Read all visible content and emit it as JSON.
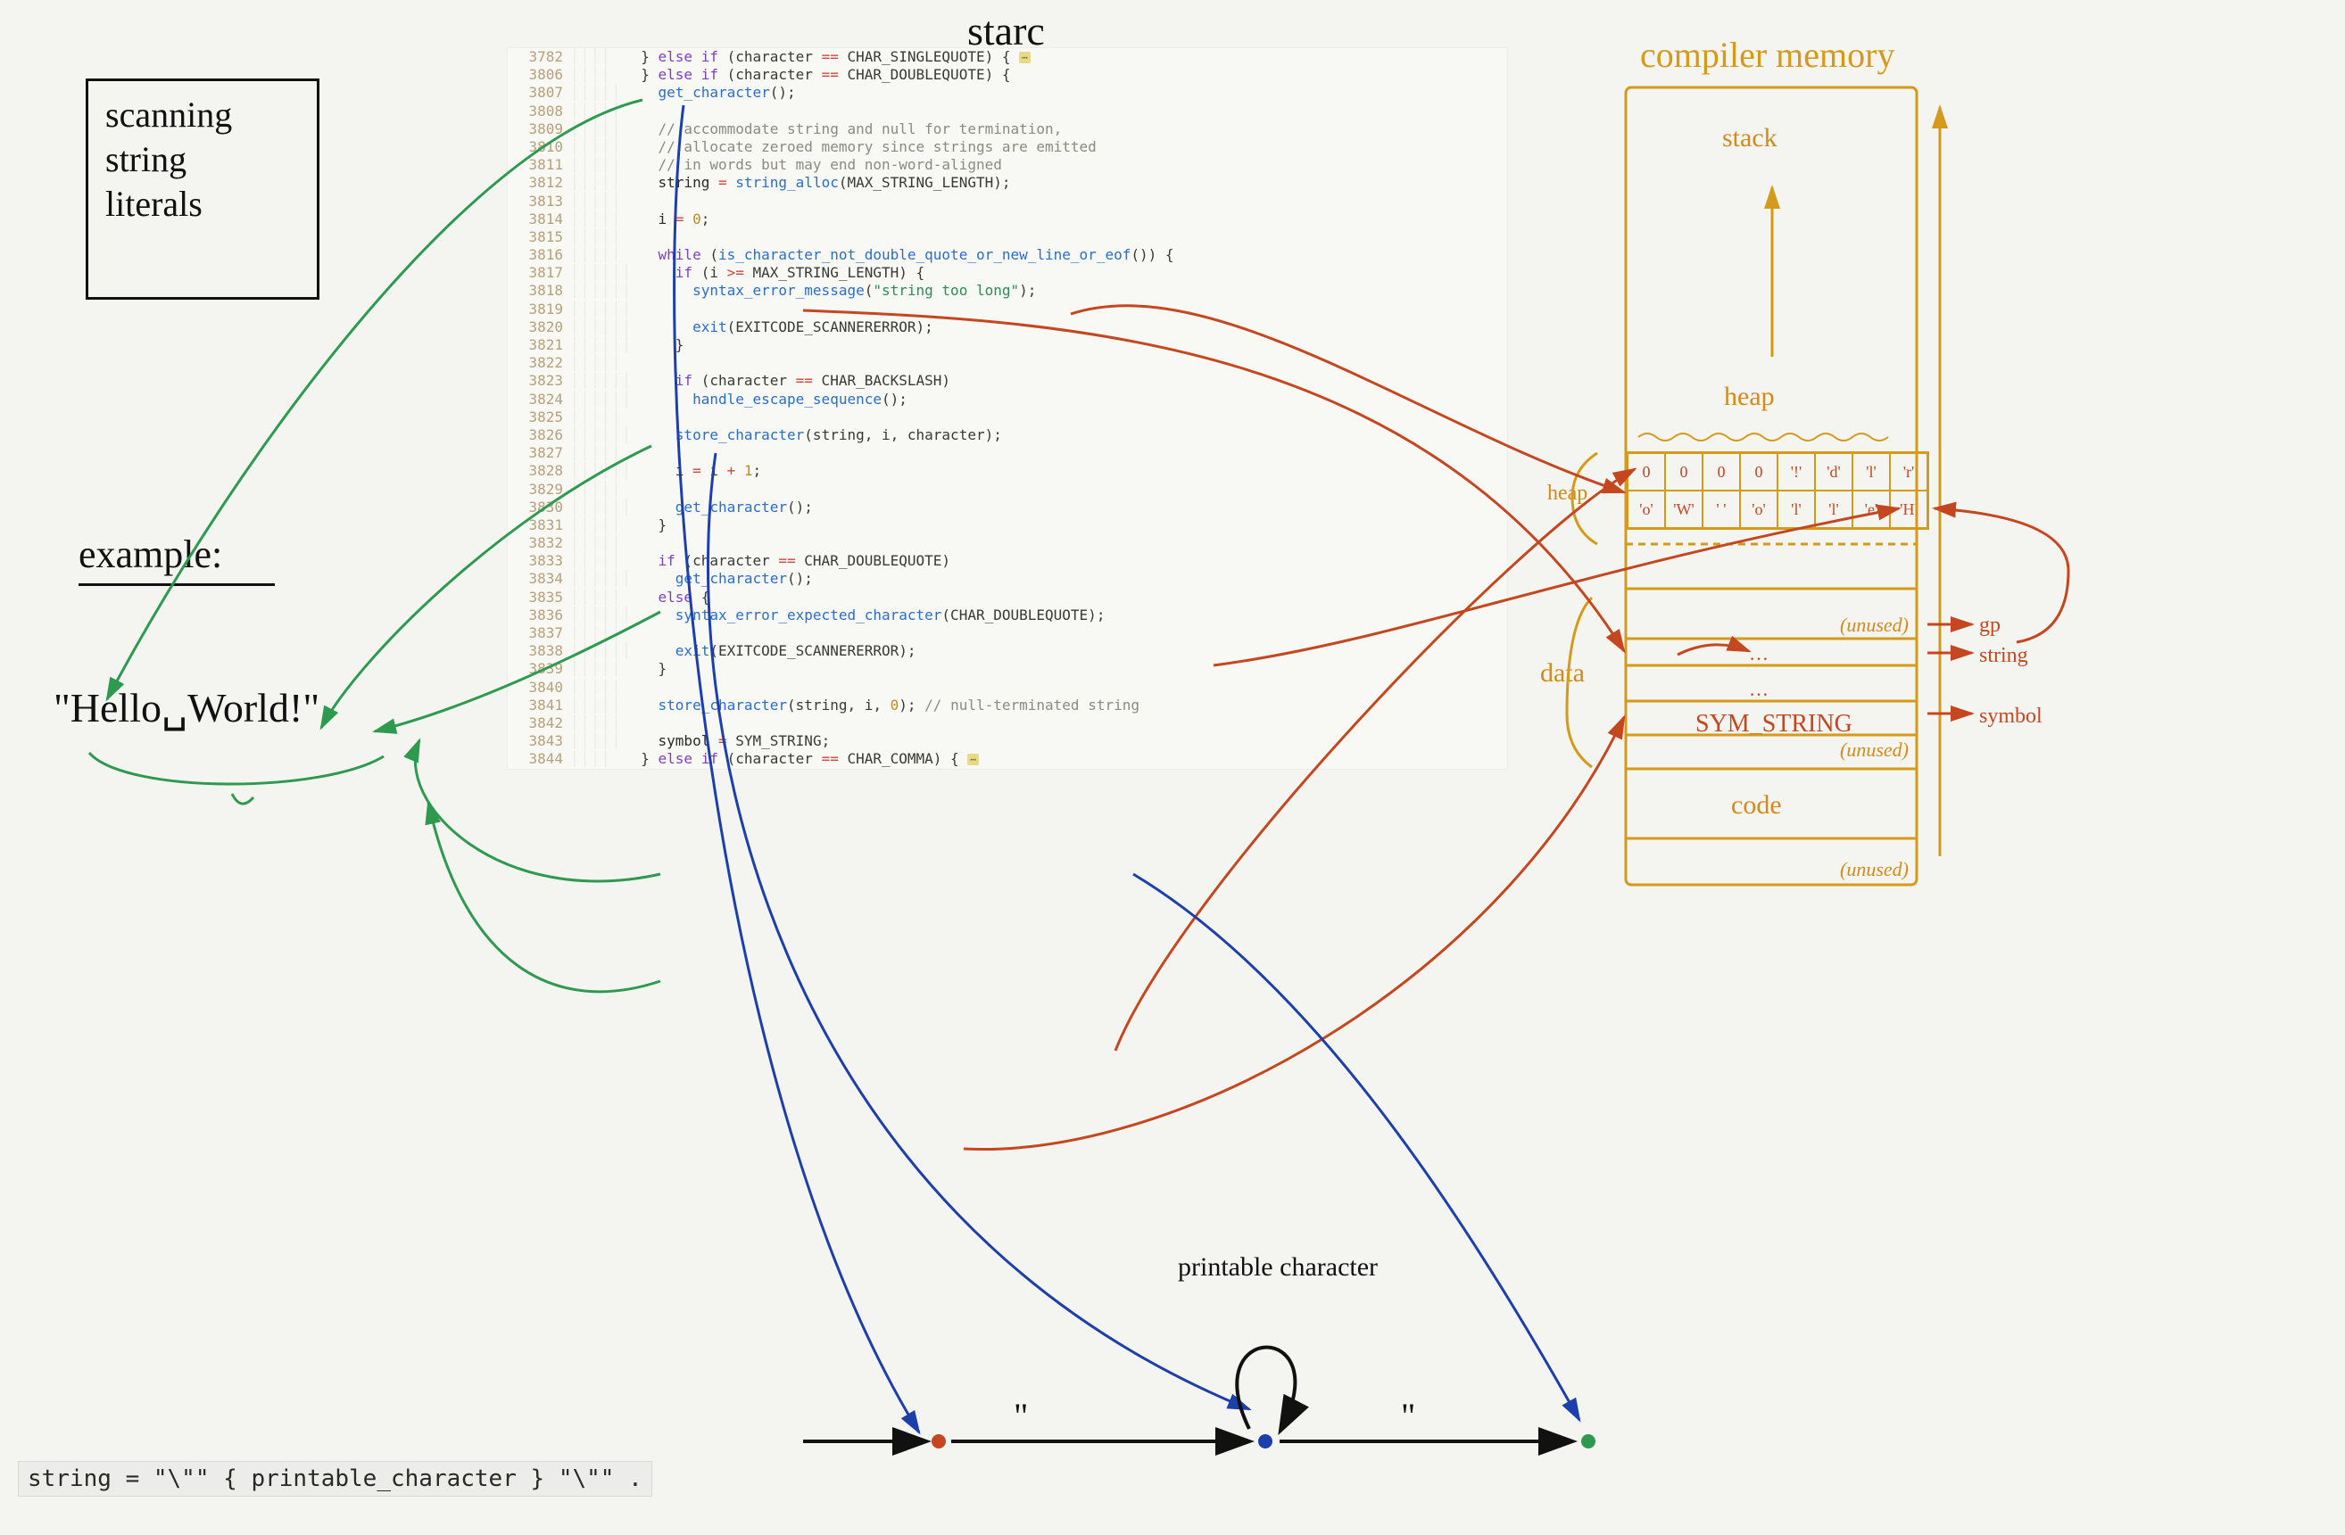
{
  "title_hw": "starc",
  "box": {
    "l1": "scanning",
    "l2": "string",
    "l3": "literals"
  },
  "example_label": "example:",
  "hello": "\"Hello␣World!\"",
  "grammar": "string     = \"\\\"\" { printable_character } \"\\\"\" .",
  "printable_label": "printable character",
  "memory": {
    "title": "compiler memory",
    "stack": "stack",
    "heap": "heap",
    "heap_side": "heap",
    "data": "data",
    "code": "code",
    "sym": "SYM_STRING",
    "unused": "(unused)",
    "gp": "gp",
    "string_ptr": "string",
    "symbol_ptr": "symbol",
    "dots": "…",
    "row1": [
      "0",
      "0",
      "0",
      "0",
      "'!'",
      "'d'",
      "'l'",
      "'r'"
    ],
    "row2": [
      "'o'",
      "'W'",
      "' '",
      "'o'",
      "'l'",
      "'l'",
      "'e'",
      "'H'"
    ]
  },
  "fsm": {
    "q1": "\"",
    "q2": "\""
  },
  "code": {
    "start": 3782,
    "lines": [
      {
        "n": 3782,
        "ind": 4,
        "seg": [
          [
            "",
            "} "
          ],
          [
            "kw",
            "else if"
          ],
          [
            "",
            " (character "
          ],
          [
            "op",
            "=="
          ],
          [
            "",
            " CHAR_SINGLEQUOTE) { "
          ]
        ],
        "fold": true
      },
      {
        "n": 3806,
        "ind": 4,
        "seg": [
          [
            "",
            "} "
          ],
          [
            "kw",
            "else if"
          ],
          [
            "",
            " (character "
          ],
          [
            "op",
            "=="
          ],
          [
            "",
            " CHAR_DOUBLEQUOTE) {"
          ]
        ]
      },
      {
        "n": 3807,
        "ind": 5,
        "seg": [
          [
            "fn",
            "get_character"
          ],
          [
            "",
            "();"
          ]
        ]
      },
      {
        "n": 3808,
        "ind": 5,
        "seg": []
      },
      {
        "n": 3809,
        "ind": 5,
        "seg": [
          [
            "cmt",
            "// accommodate string and null for termination,"
          ]
        ]
      },
      {
        "n": 3810,
        "ind": 5,
        "seg": [
          [
            "cmt",
            "// allocate zeroed memory since strings are emitted"
          ]
        ]
      },
      {
        "n": 3811,
        "ind": 5,
        "seg": [
          [
            "cmt",
            "// in words but may end non-word-aligned"
          ]
        ]
      },
      {
        "n": 3812,
        "ind": 5,
        "seg": [
          [
            "id",
            "string"
          ],
          [
            "",
            " "
          ],
          [
            "op",
            "="
          ],
          [
            "",
            " "
          ],
          [
            "fn",
            "string_alloc"
          ],
          [
            "",
            "(MAX_STRING_LENGTH);"
          ]
        ]
      },
      {
        "n": 3813,
        "ind": 5,
        "seg": []
      },
      {
        "n": 3814,
        "ind": 5,
        "seg": [
          [
            "id",
            "i"
          ],
          [
            "",
            " "
          ],
          [
            "op",
            "="
          ],
          [
            "",
            " "
          ],
          [
            "num",
            "0"
          ],
          [
            "",
            ";"
          ]
        ]
      },
      {
        "n": 3815,
        "ind": 5,
        "seg": []
      },
      {
        "n": 3816,
        "ind": 5,
        "seg": [
          [
            "kw",
            "while"
          ],
          [
            "",
            " ("
          ],
          [
            "fn",
            "is_character_not_double_quote_or_new_line_or_eof"
          ],
          [
            "",
            "()) {"
          ]
        ]
      },
      {
        "n": 3817,
        "ind": 6,
        "seg": [
          [
            "kw",
            "if"
          ],
          [
            "",
            " (i "
          ],
          [
            "op",
            ">="
          ],
          [
            "",
            " MAX_STRING_LENGTH) {"
          ]
        ]
      },
      {
        "n": 3818,
        "ind": 7,
        "seg": [
          [
            "fn",
            "syntax_error_message"
          ],
          [
            "",
            "("
          ],
          [
            "str",
            "\"string too long\""
          ],
          [
            "",
            ");"
          ]
        ]
      },
      {
        "n": 3819,
        "ind": 6,
        "seg": []
      },
      {
        "n": 3820,
        "ind": 7,
        "seg": [
          [
            "fn",
            "exit"
          ],
          [
            "",
            "(EXITCODE_SCANNERERROR);"
          ]
        ]
      },
      {
        "n": 3821,
        "ind": 6,
        "seg": [
          [
            "",
            "}"
          ]
        ]
      },
      {
        "n": 3822,
        "ind": 5,
        "seg": []
      },
      {
        "n": 3823,
        "ind": 6,
        "seg": [
          [
            "kw",
            "if"
          ],
          [
            "",
            " (character "
          ],
          [
            "op",
            "=="
          ],
          [
            "",
            " CHAR_BACKSLASH)"
          ]
        ]
      },
      {
        "n": 3824,
        "ind": 7,
        "seg": [
          [
            "fn",
            "handle_escape_sequence"
          ],
          [
            "",
            "();"
          ]
        ]
      },
      {
        "n": 3825,
        "ind": 5,
        "seg": []
      },
      {
        "n": 3826,
        "ind": 6,
        "seg": [
          [
            "fn",
            "store_character"
          ],
          [
            "",
            "(string, i, character);"
          ]
        ]
      },
      {
        "n": 3827,
        "ind": 5,
        "seg": []
      },
      {
        "n": 3828,
        "ind": 6,
        "seg": [
          [
            "id",
            "i"
          ],
          [
            "",
            " "
          ],
          [
            "op",
            "="
          ],
          [
            "",
            " i "
          ],
          [
            "op",
            "+"
          ],
          [
            "",
            " "
          ],
          [
            "num",
            "1"
          ],
          [
            "",
            ";"
          ]
        ]
      },
      {
        "n": 3829,
        "ind": 5,
        "seg": []
      },
      {
        "n": 3830,
        "ind": 6,
        "seg": [
          [
            "fn",
            "get_character"
          ],
          [
            "",
            "();"
          ]
        ]
      },
      {
        "n": 3831,
        "ind": 5,
        "seg": [
          [
            "",
            "}"
          ]
        ]
      },
      {
        "n": 3832,
        "ind": 5,
        "seg": []
      },
      {
        "n": 3833,
        "ind": 5,
        "seg": [
          [
            "kw",
            "if"
          ],
          [
            "",
            " (character "
          ],
          [
            "op",
            "=="
          ],
          [
            "",
            " CHAR_DOUBLEQUOTE)"
          ]
        ]
      },
      {
        "n": 3834,
        "ind": 6,
        "seg": [
          [
            "fn",
            "get_character"
          ],
          [
            "",
            "();"
          ]
        ]
      },
      {
        "n": 3835,
        "ind": 5,
        "seg": [
          [
            "kw",
            "else"
          ],
          [
            "",
            " {"
          ]
        ]
      },
      {
        "n": 3836,
        "ind": 6,
        "seg": [
          [
            "fn",
            "syntax_error_expected_character"
          ],
          [
            "",
            "(CHAR_DOUBLEQUOTE);"
          ]
        ]
      },
      {
        "n": 3837,
        "ind": 5,
        "seg": []
      },
      {
        "n": 3838,
        "ind": 6,
        "seg": [
          [
            "fn",
            "exit"
          ],
          [
            "",
            "(EXITCODE_SCANNERERROR);"
          ]
        ]
      },
      {
        "n": 3839,
        "ind": 5,
        "seg": [
          [
            "",
            "}"
          ]
        ]
      },
      {
        "n": 3840,
        "ind": 5,
        "seg": []
      },
      {
        "n": 3841,
        "ind": 5,
        "seg": [
          [
            "fn",
            "store_character"
          ],
          [
            "",
            "(string, i, "
          ],
          [
            "num",
            "0"
          ],
          [
            "",
            "); "
          ],
          [
            "cmt",
            "// null-terminated string"
          ]
        ]
      },
      {
        "n": 3842,
        "ind": 5,
        "seg": []
      },
      {
        "n": 3843,
        "ind": 5,
        "seg": [
          [
            "id",
            "symbol"
          ],
          [
            "",
            " "
          ],
          [
            "op",
            "="
          ],
          [
            "",
            " SYM_STRING;"
          ]
        ]
      },
      {
        "n": 3844,
        "ind": 4,
        "seg": [
          [
            "",
            "} "
          ],
          [
            "kw",
            "else if"
          ],
          [
            "",
            " (character "
          ],
          [
            "op",
            "=="
          ],
          [
            "",
            " CHAR_COMMA) { "
          ]
        ],
        "fold": true
      }
    ]
  }
}
